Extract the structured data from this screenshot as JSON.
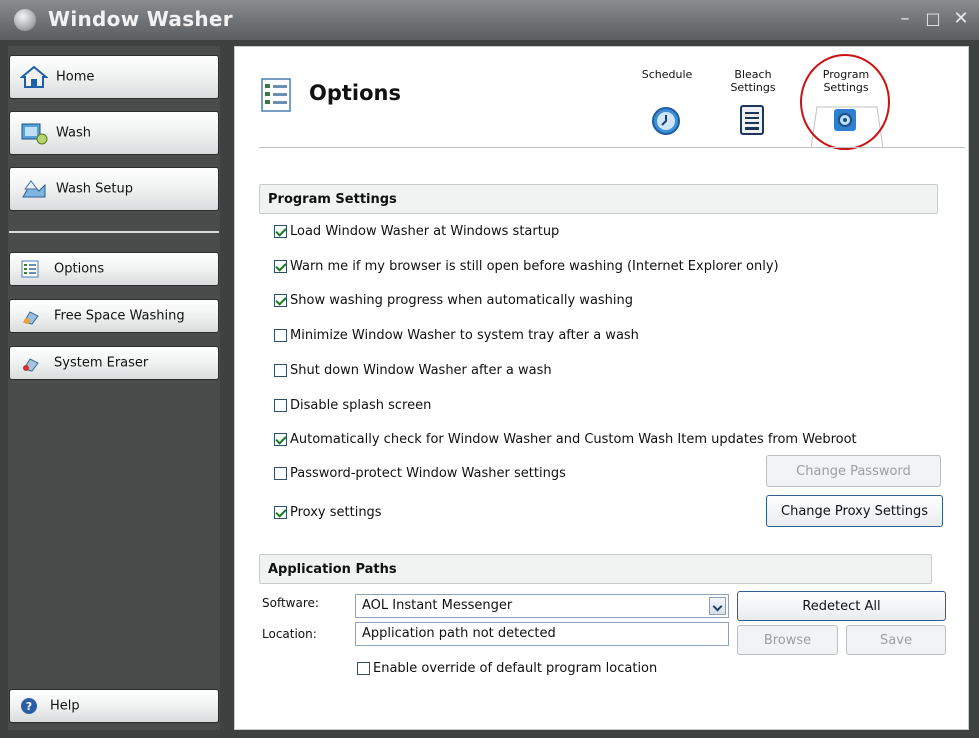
{
  "window": {
    "title": "Window Washer"
  },
  "sidebar": {
    "items": [
      {
        "label": "Home",
        "icon": "home-icon"
      },
      {
        "label": "Wash",
        "icon": "wash-icon"
      },
      {
        "label": "Wash Setup",
        "icon": "wash-setup-icon"
      },
      {
        "label": "Options",
        "icon": "options-icon"
      },
      {
        "label": "Free Space Washing",
        "icon": "free-space-icon"
      },
      {
        "label": "System Eraser",
        "icon": "system-eraser-icon"
      }
    ],
    "help": "Help"
  },
  "options": {
    "title": "Options",
    "tabs": [
      {
        "label": "Schedule",
        "icon": "clock-icon"
      },
      {
        "label": "Bleach Settings",
        "icon": "document-icon"
      },
      {
        "label": "Program Settings",
        "icon": "gear-icon",
        "active": true
      }
    ],
    "program_settings": {
      "header": "Program Settings",
      "checkboxes": [
        {
          "label": "Load Window Washer at Windows startup",
          "checked": true
        },
        {
          "label": "Warn me if my browser is still open before washing (Internet Explorer only)",
          "checked": true
        },
        {
          "label": "Show washing progress when automatically washing",
          "checked": true
        },
        {
          "label": "Minimize Window Washer to system tray after a wash",
          "checked": false
        },
        {
          "label": "Shut down Window Washer after a wash",
          "checked": false
        },
        {
          "label": "Disable splash screen",
          "checked": false
        },
        {
          "label": "Automatically check for Window Washer and Custom Wash Item updates from Webroot",
          "checked": true
        },
        {
          "label": "Password-protect Window Washer settings",
          "checked": false
        },
        {
          "label": "Proxy settings",
          "checked": true
        }
      ],
      "change_password": "Change Password",
      "change_proxy": "Change Proxy Settings"
    },
    "application_paths": {
      "header": "Application Paths",
      "software_label": "Software:",
      "software_value": "AOL Instant Messenger",
      "location_label": "Location:",
      "location_value": "Application path not detected",
      "redetect": "Redetect All",
      "browse": "Browse",
      "save": "Save",
      "override": {
        "label": "Enable override of default program location",
        "checked": false
      }
    }
  }
}
